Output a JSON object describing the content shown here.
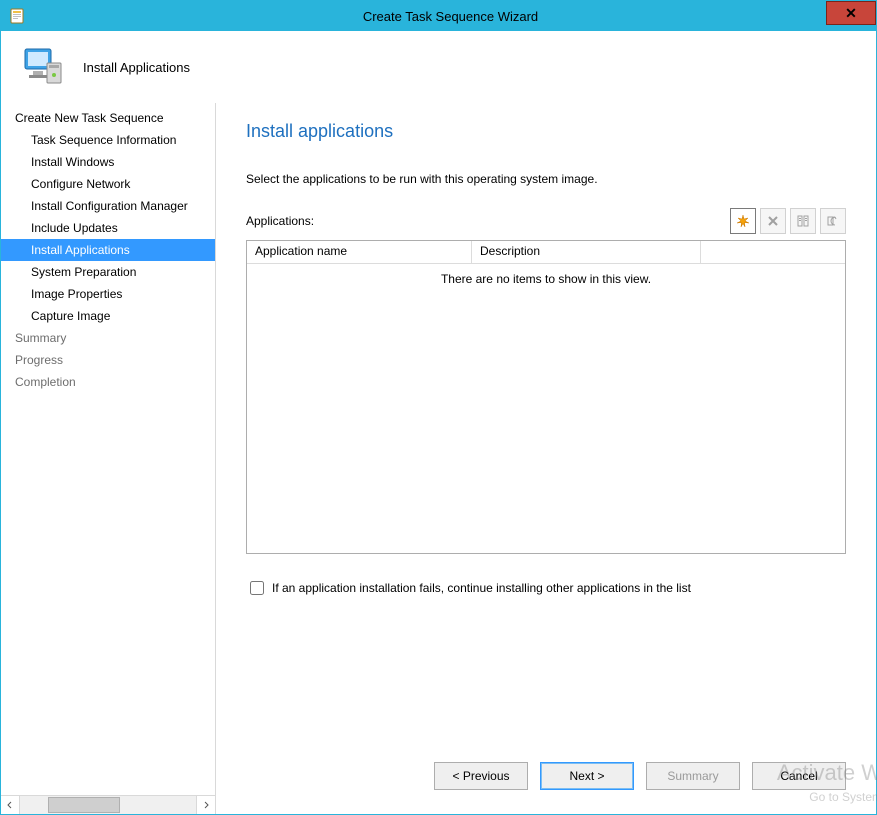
{
  "window": {
    "title": "Create Task Sequence Wizard"
  },
  "header": {
    "stepTitle": "Install Applications"
  },
  "nav": {
    "items": [
      {
        "label": "Create New Task Sequence",
        "level": 0,
        "state": "normal"
      },
      {
        "label": "Task Sequence Information",
        "level": 1,
        "state": "normal"
      },
      {
        "label": "Install Windows",
        "level": 1,
        "state": "normal"
      },
      {
        "label": "Configure Network",
        "level": 1,
        "state": "normal"
      },
      {
        "label": "Install Configuration Manager",
        "level": 1,
        "state": "normal"
      },
      {
        "label": "Include Updates",
        "level": 1,
        "state": "normal"
      },
      {
        "label": "Install Applications",
        "level": 1,
        "state": "selected"
      },
      {
        "label": "System Preparation",
        "level": 1,
        "state": "normal"
      },
      {
        "label": "Image Properties",
        "level": 1,
        "state": "normal"
      },
      {
        "label": "Capture Image",
        "level": 1,
        "state": "normal"
      },
      {
        "label": "Summary",
        "level": 0,
        "state": "disabled"
      },
      {
        "label": "Progress",
        "level": 0,
        "state": "disabled"
      },
      {
        "label": "Completion",
        "level": 0,
        "state": "disabled"
      }
    ]
  },
  "main": {
    "heading": "Install applications",
    "instruction": "Select the applications to be run with this operating system image.",
    "listLabel": "Applications:",
    "columns": {
      "name": "Application name",
      "desc": "Description"
    },
    "emptyText": "There are no items to show in this view.",
    "toolbar": {
      "new": "New",
      "delete": "Delete",
      "properties": "Properties",
      "moveUp": "Move Up"
    },
    "checkboxLabel": "If an application installation fails, continue installing other applications in the list"
  },
  "footer": {
    "previous": "< Previous",
    "next": "Next >",
    "summary": "Summary",
    "cancel": "Cancel"
  },
  "watermark": {
    "line1": "Activate W",
    "line2": "Go to System"
  }
}
